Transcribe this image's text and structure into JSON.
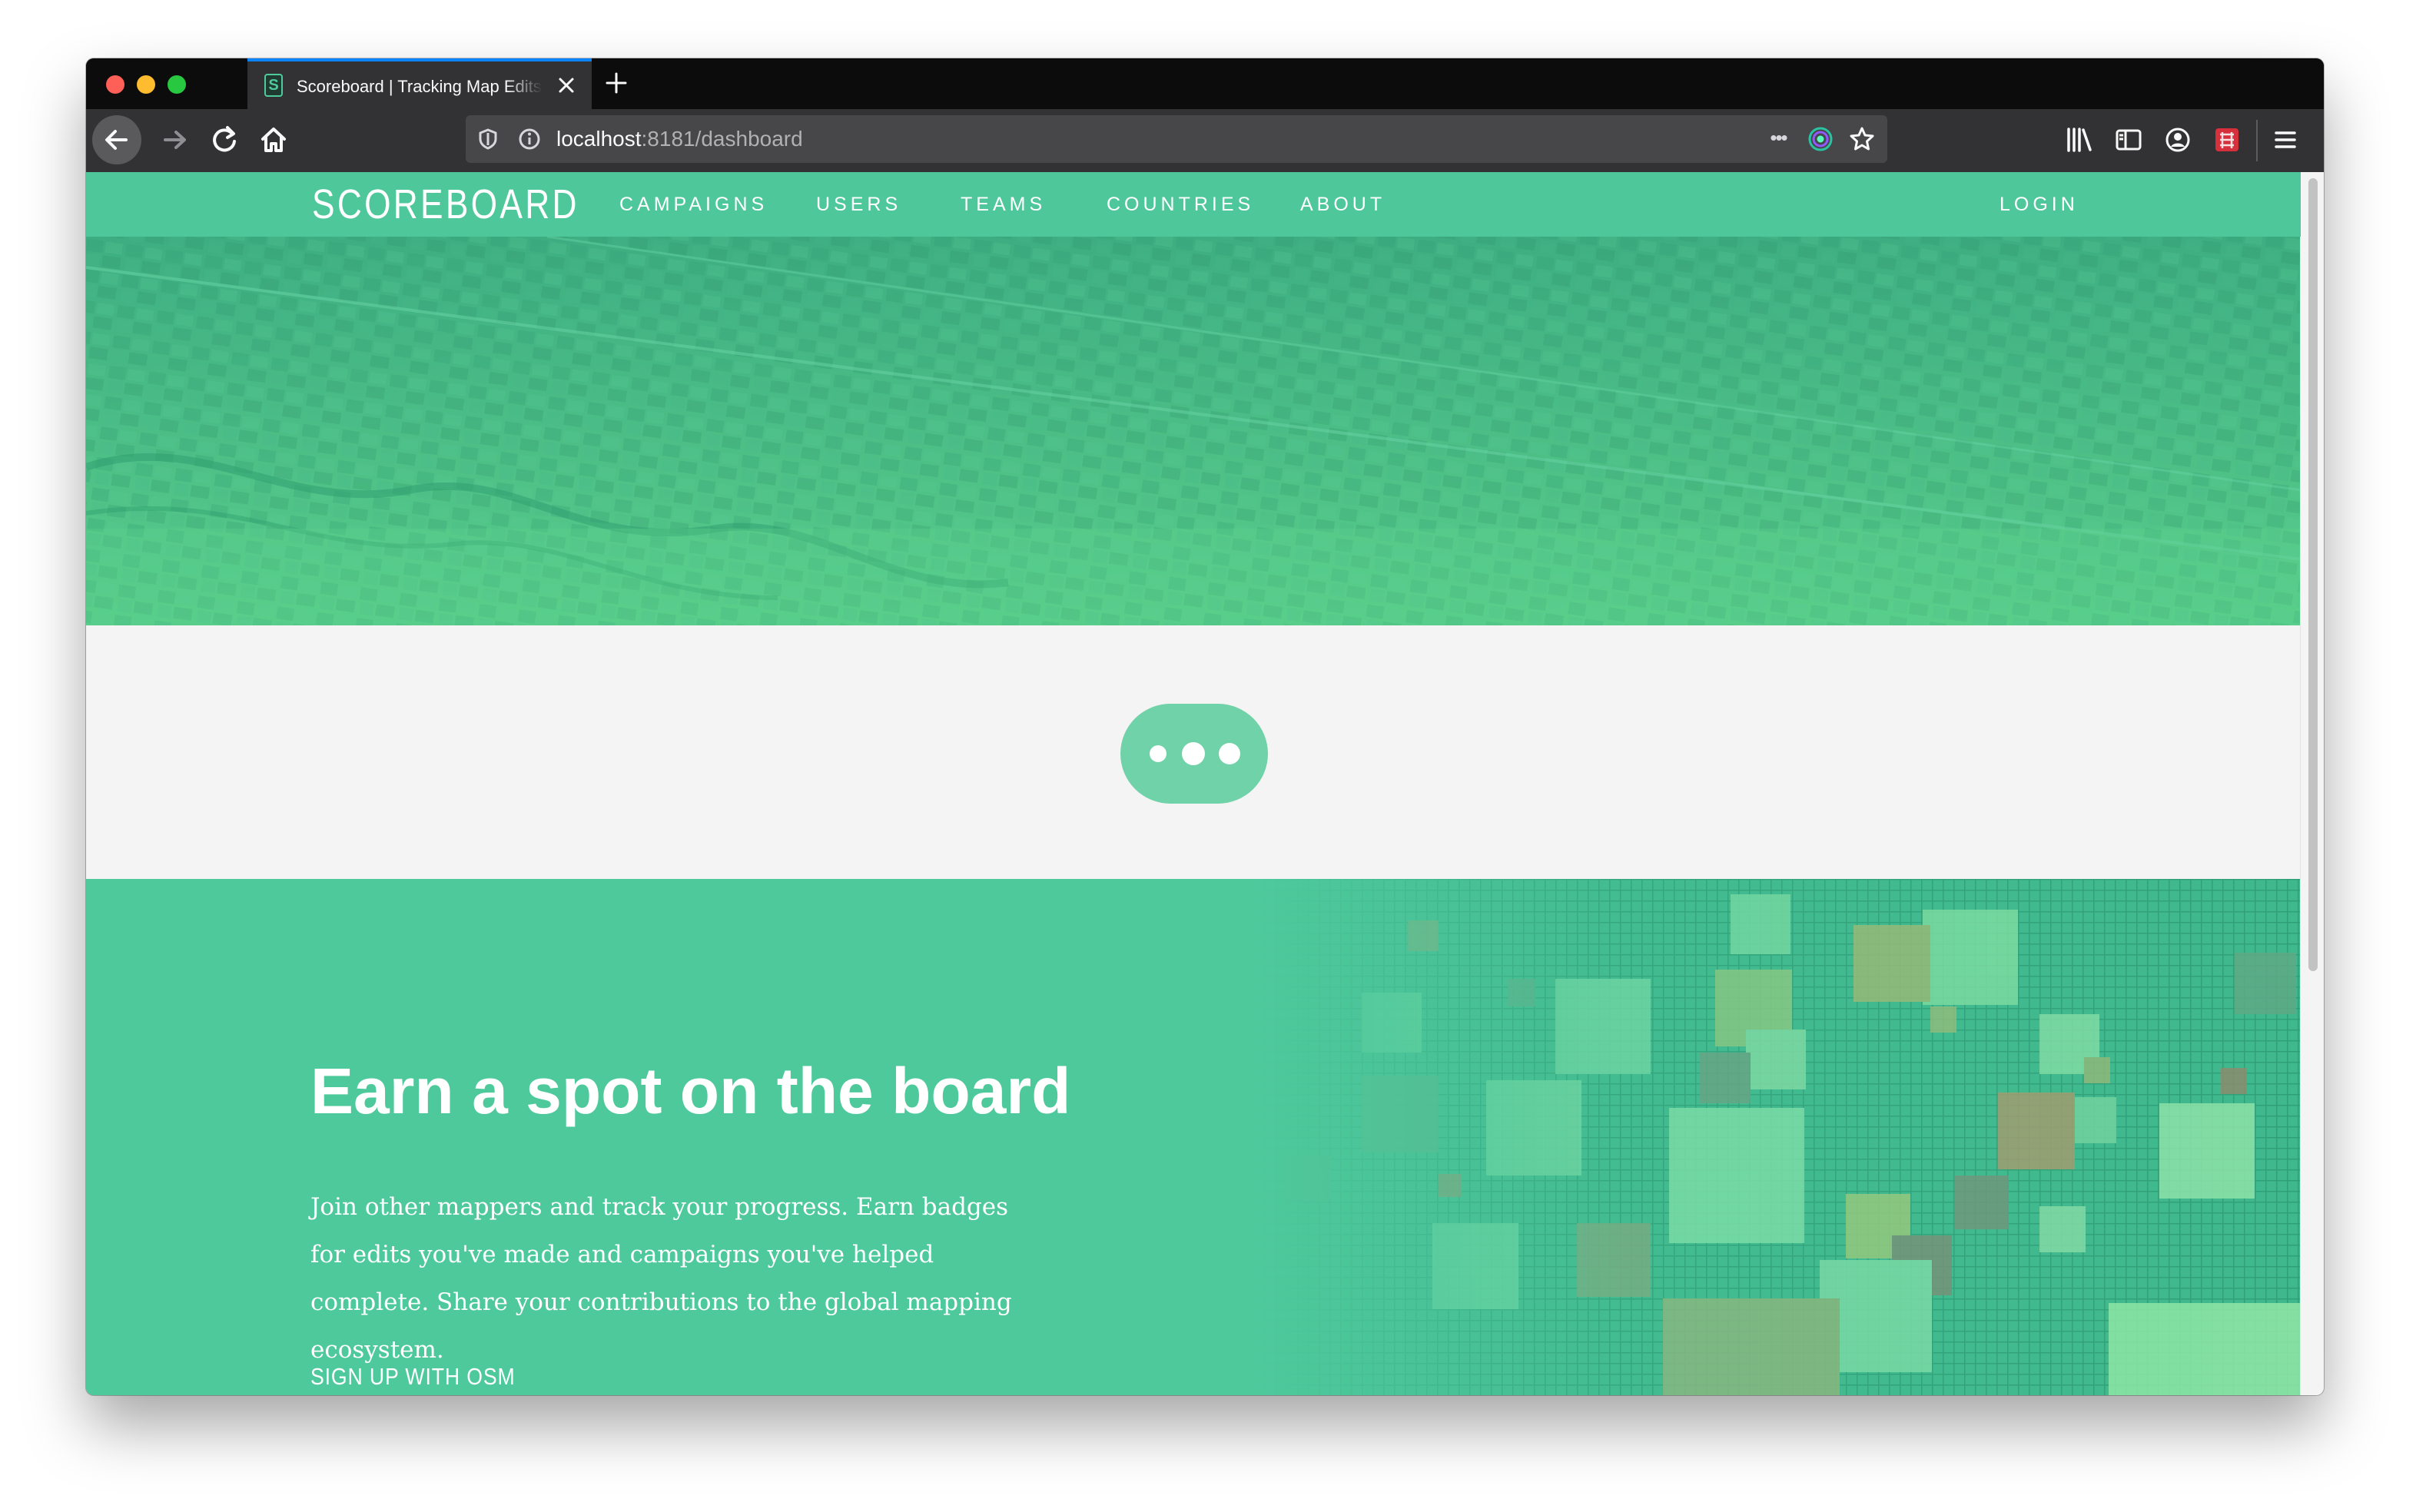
{
  "browser": {
    "tab_title": "Scoreboard | Tracking Map Edits",
    "url_host": "localhost",
    "url_path": ":8181/dashboard",
    "page_actions_label": "•••"
  },
  "site": {
    "brand": "SCOREBOARD",
    "nav": [
      "CAMPAIGNS",
      "USERS",
      "TEAMS",
      "COUNTRIES",
      "ABOUT"
    ],
    "login": "LOGIN"
  },
  "promo": {
    "heading": "Earn a spot on the board",
    "body": "Join other mappers and track your progress. Earn badges for edits you've made and campaigns you've helped complete. Share your contributions to the global mapping ecosystem.",
    "cta": "SIGN UP WITH OSM"
  },
  "colors": {
    "brand_green": "#4ec89b",
    "loader_green": "#6fd2a8",
    "page_bg": "#f4f4f4",
    "toolbar_bg": "#323234",
    "tab_accent": "#0a84ff"
  },
  "icons": [
    "back-arrow-icon",
    "forward-arrow-icon",
    "reload-icon",
    "home-icon",
    "shield-icon",
    "info-icon",
    "page-actions-icon",
    "tracking-icon",
    "bookmark-star-icon",
    "library-icon",
    "sidebar-icon",
    "account-icon",
    "extension-icon",
    "menu-icon",
    "loading-dots-icon"
  ]
}
